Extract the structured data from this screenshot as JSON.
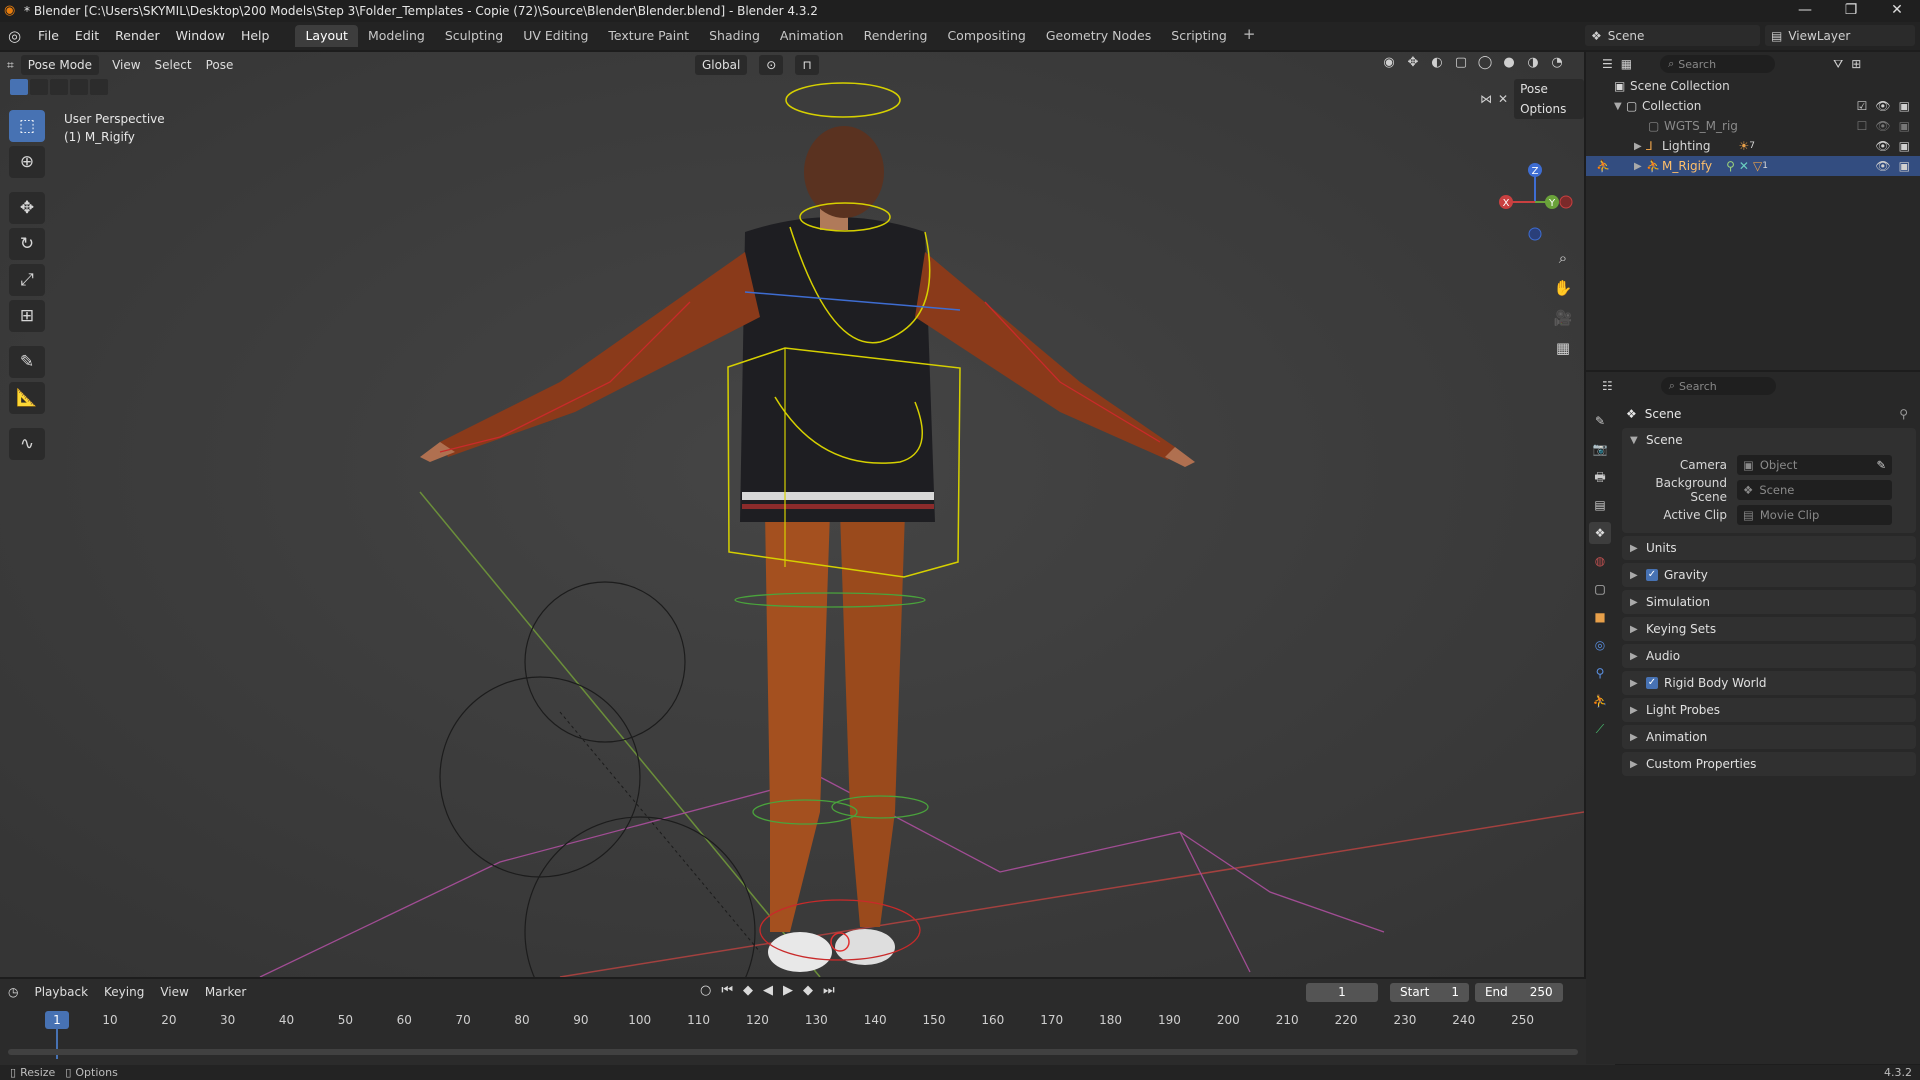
{
  "window": {
    "title": "* Blender [C:\\Users\\SKYMIL\\Desktop\\200 Models\\Step 3\\Folder_Templates - Copie (72)\\Source\\Blender\\Blender.blend] - Blender 4.3.2",
    "controls": [
      "—",
      "❐",
      "✕"
    ]
  },
  "menu": [
    "File",
    "Edit",
    "Render",
    "Window",
    "Help"
  ],
  "workspaces": [
    "Layout",
    "Modeling",
    "Sculpting",
    "UV Editing",
    "Texture Paint",
    "Shading",
    "Animation",
    "Rendering",
    "Compositing",
    "Geometry Nodes",
    "Scripting"
  ],
  "active_workspace": "Layout",
  "scene": {
    "name": "Scene",
    "view_layer": "ViewLayer"
  },
  "viewport": {
    "mode": "Pose Mode",
    "menus": [
      "View",
      "Select",
      "Pose"
    ],
    "orientation": "Global",
    "pose_options": "Pose Options",
    "info_line1": "User Perspective",
    "info_line2": "(1) M_Rigify",
    "gizmo_axes": {
      "x": "X",
      "y": "Y",
      "z": "Z"
    }
  },
  "timeline": {
    "menus": [
      "Playback",
      "Keying",
      "View",
      "Marker"
    ],
    "current_frame": "1",
    "start_label": "Start",
    "start": "1",
    "end_label": "End",
    "end": "250",
    "ticks": [
      "10",
      "20",
      "30",
      "40",
      "50",
      "60",
      "70",
      "80",
      "90",
      "100",
      "110",
      "120",
      "130",
      "140",
      "150",
      "160",
      "170",
      "180",
      "190",
      "200",
      "210",
      "220",
      "230",
      "240",
      "250"
    ],
    "playhead_label": "1"
  },
  "statusbar": {
    "left1": "Resize",
    "left2": "Options",
    "version": "4.3.2"
  },
  "outliner": {
    "search_placeholder": "Search",
    "rows": [
      {
        "label": "Scene Collection"
      },
      {
        "label": "Collection"
      },
      {
        "label": "WGTS_M_rig"
      },
      {
        "label": "Lighting",
        "badge": "7"
      },
      {
        "label": "M_Rigify",
        "badge": "1"
      }
    ]
  },
  "properties": {
    "search_placeholder": "Search",
    "title": "Scene",
    "panel_scene": "Scene",
    "fields": [
      {
        "label": "Camera",
        "placeholder": "Object"
      },
      {
        "label": "Background Scene",
        "placeholder": "Scene"
      },
      {
        "label": "Active Clip",
        "placeholder": "Movie Clip"
      }
    ],
    "subpanels": [
      {
        "label": "Units",
        "checkbox": false
      },
      {
        "label": "Gravity",
        "checkbox": true
      },
      {
        "label": "Simulation",
        "checkbox": false
      },
      {
        "label": "Keying Sets",
        "checkbox": false
      },
      {
        "label": "Audio",
        "checkbox": false
      },
      {
        "label": "Rigid Body World",
        "checkbox": true
      },
      {
        "label": "Light Probes",
        "checkbox": false
      },
      {
        "label": "Animation",
        "checkbox": false
      },
      {
        "label": "Custom Properties",
        "checkbox": false
      }
    ]
  },
  "colors": {
    "accent": "#4772b3",
    "selected_row": "#334d80",
    "blender_orange": "#e87d0d"
  }
}
